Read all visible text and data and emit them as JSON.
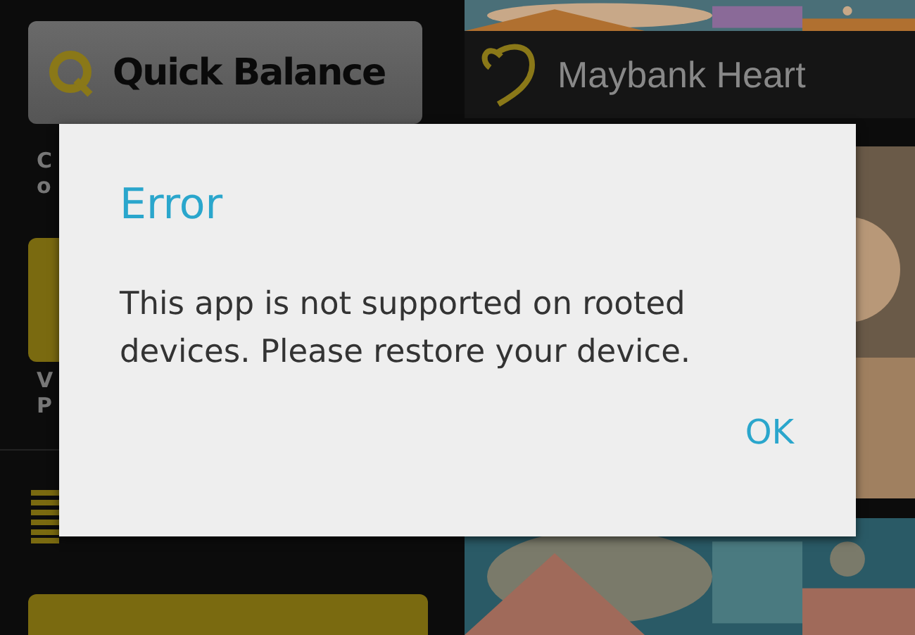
{
  "background": {
    "quick_balance": "Quick Balance",
    "heart_tile": "Maybank Heart",
    "left_texts": [
      "C",
      "o",
      "V",
      "P"
    ]
  },
  "dialog": {
    "title": "Error",
    "message": "This app is not supported on rooted devices. Please restore your device.",
    "buttons": [
      "OK"
    ]
  }
}
